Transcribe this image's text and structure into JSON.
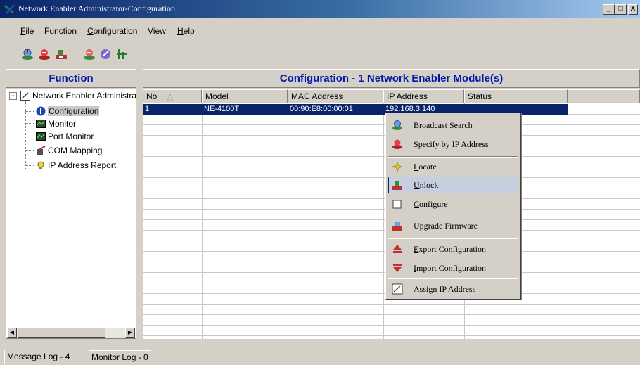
{
  "window": {
    "title": "Network Enabler Administrator-Configuration",
    "minimize": "_",
    "maximize": "□",
    "close": "X"
  },
  "menu": [
    {
      "hot": "F",
      "rest": "ile"
    },
    {
      "hot": "",
      "rest": "Function"
    },
    {
      "hot": "C",
      "rest": "onfiguration"
    },
    {
      "hot": "",
      "rest": "View"
    },
    {
      "hot": "H",
      "rest": "elp"
    }
  ],
  "toolbar": {
    "icons": [
      "broadcast-search-icon",
      "specify-ip-icon",
      "unlock-icon",
      "configure-icon",
      "upgrade-icon",
      "locate-icon"
    ]
  },
  "function_panel": {
    "header": "Function",
    "tree_root": "Network Enabler Administrator",
    "tree_items": [
      "Configuration",
      "Monitor",
      "Port Monitor",
      "COM Mapping",
      "IP Address Report"
    ]
  },
  "config_panel": {
    "header": "Configuration - 1 Network Enabler Module(s)",
    "columns": [
      "No",
      "Model",
      "MAC Address",
      "IP Address",
      "Status"
    ],
    "rows": [
      {
        "no": "1",
        "model": "NE-4100T",
        "mac": "00:90:E8:00:00:01",
        "ip": "192.168.3.140",
        "status": ""
      }
    ]
  },
  "context_menu": {
    "items": [
      {
        "hot": "B",
        "rest": "roadcast Search",
        "icon": "broadcast-search-icon"
      },
      {
        "hot": "S",
        "rest": "pecify by IP Address",
        "icon": "specify-ip-icon"
      },
      {
        "hot": "L",
        "rest": "ocate",
        "icon": "locate-icon"
      },
      {
        "hot": "U",
        "rest": "nlock",
        "icon": "unlock-icon",
        "selected": true
      },
      {
        "hot": "C",
        "rest": "onfigure",
        "icon": "configure-icon"
      },
      {
        "hot": "",
        "pre": "Up",
        "hot2": "g",
        "rest": "rade Firmware",
        "icon": "upgrade-firmware-icon"
      },
      {
        "hot": "E",
        "rest": "xport Configuration",
        "icon": "export-icon"
      },
      {
        "hot": "I",
        "rest": "mport Configuration",
        "icon": "import-icon"
      },
      {
        "hot": "A",
        "rest": "ssign IP Address",
        "icon": "assign-ip-icon"
      }
    ]
  },
  "bottom_tabs": [
    "Message Log - 4",
    "Monitor Log - 0"
  ],
  "colors": {
    "title_bar": "#0a246a",
    "header_text": "#0018a8",
    "selection": "#0a246a"
  }
}
